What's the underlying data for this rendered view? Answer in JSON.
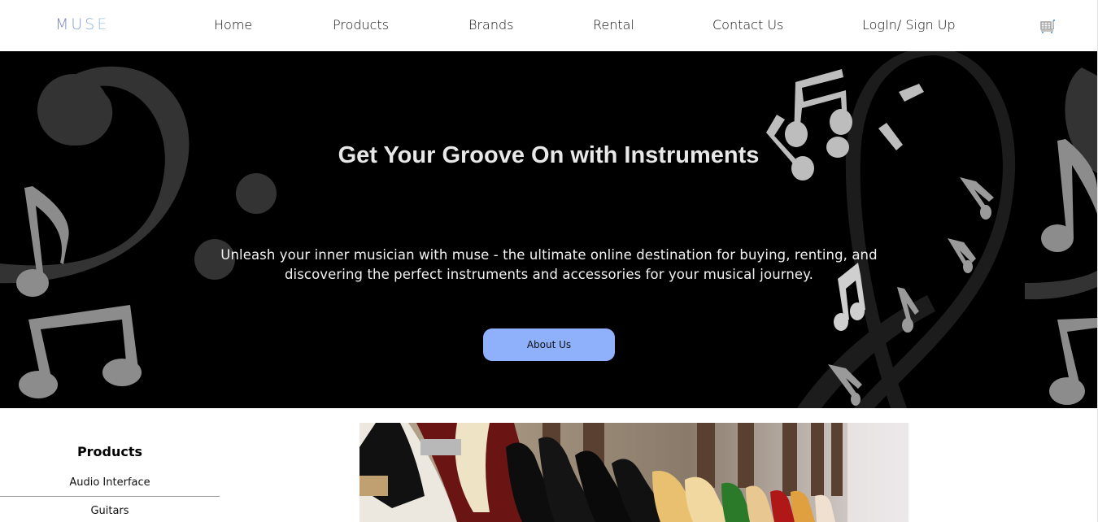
{
  "navbar": {
    "logo": "MUSE",
    "links": [
      "Home",
      "Products",
      "Brands",
      "Rental",
      "Contact Us",
      "LogIn/ Sign Up"
    ],
    "cart_icon": "shopping-cart-icon"
  },
  "hero": {
    "title": "Get Your Groove On with Instruments",
    "subtitle": "Unleash your inner musician with muse - the ultimate online destination for buying, renting, and discovering the perfect instruments and accessories for your musical journey.",
    "button_label": "About Us",
    "button_color": "#8fb0fb",
    "background_icons": [
      "bass-clef-icon",
      "eighth-note-icon",
      "beamed-notes-icon",
      "treble-clef-icon",
      "sixteenth-note-icon"
    ]
  },
  "products": {
    "title": "Products",
    "items": [
      "Audio Interface",
      "Guitars"
    ]
  },
  "banner": {
    "image": "guitars-banner-image"
  }
}
